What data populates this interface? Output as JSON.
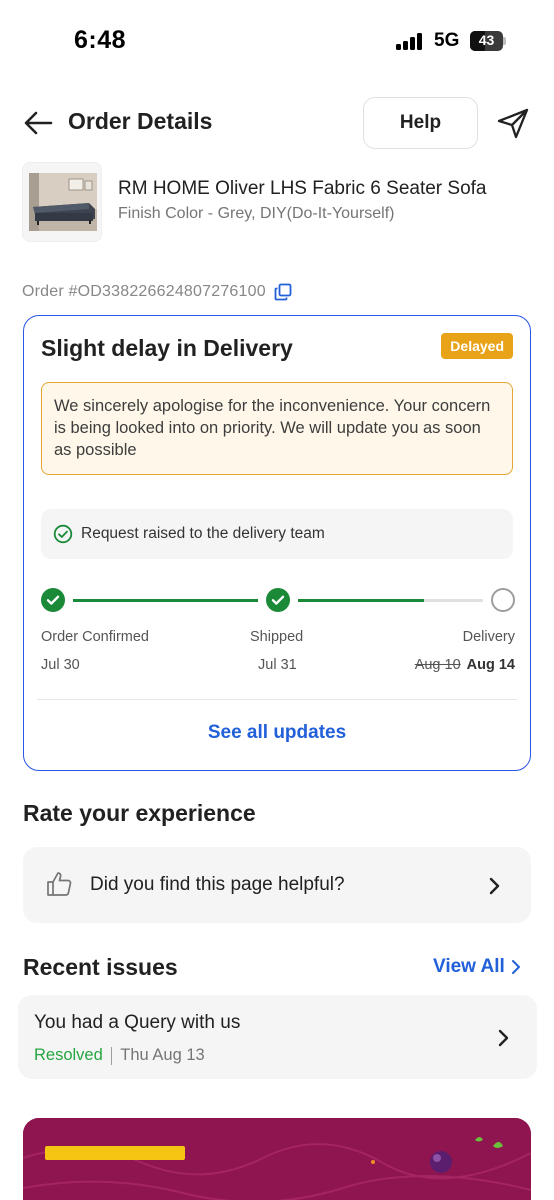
{
  "status_bar": {
    "time": "6:48",
    "network": "5G",
    "battery": "43"
  },
  "header": {
    "title": "Order Details",
    "help_label": "Help"
  },
  "product": {
    "name": "RM HOME Oliver LHS Fabric 6 Seater Sofa",
    "variant": "Finish Color - Grey, DIY(Do-It-Yourself)"
  },
  "order": {
    "id_text": "Order #OD338226624807276100"
  },
  "delivery": {
    "heading": "Slight delay in Delivery",
    "badge": "Delayed",
    "apology": "We sincerely apologise for the inconvenience. Your concern is being looked into on priority. We will update you as soon as possible",
    "request_text": "Request raised to the delivery team",
    "steps": [
      {
        "label": "Order Confirmed",
        "date": "Jul 30",
        "done": true
      },
      {
        "label": "Shipped",
        "date": "Jul 31",
        "done": true
      },
      {
        "label": "Delivery",
        "old_date": "Aug 10",
        "new_date": "Aug 14",
        "done": false
      }
    ],
    "see_all_label": "See all updates"
  },
  "rate": {
    "title": "Rate your experience",
    "question": "Did you find this page helpful?"
  },
  "issues": {
    "title": "Recent issues",
    "view_all_label": "View All",
    "items": [
      {
        "title": "You had a Query with us",
        "status": "Resolved",
        "date": "Thu Aug 13"
      }
    ]
  },
  "colors": {
    "accent_blue": "#2160d9",
    "card_border": "#2a55e5",
    "delayed_badge": "#e9a318",
    "success_green": "#1a8a38",
    "resolved_green": "#26a541",
    "banner": "#8e1550"
  },
  "icons": {
    "back": "back-arrow-icon",
    "share": "share-icon",
    "copy": "copy-icon",
    "check": "check-circle-icon",
    "thumb": "thumbs-up-icon",
    "chevron": "chevron-right-icon"
  },
  "tracker": {
    "progress_fraction": 0.68
  }
}
